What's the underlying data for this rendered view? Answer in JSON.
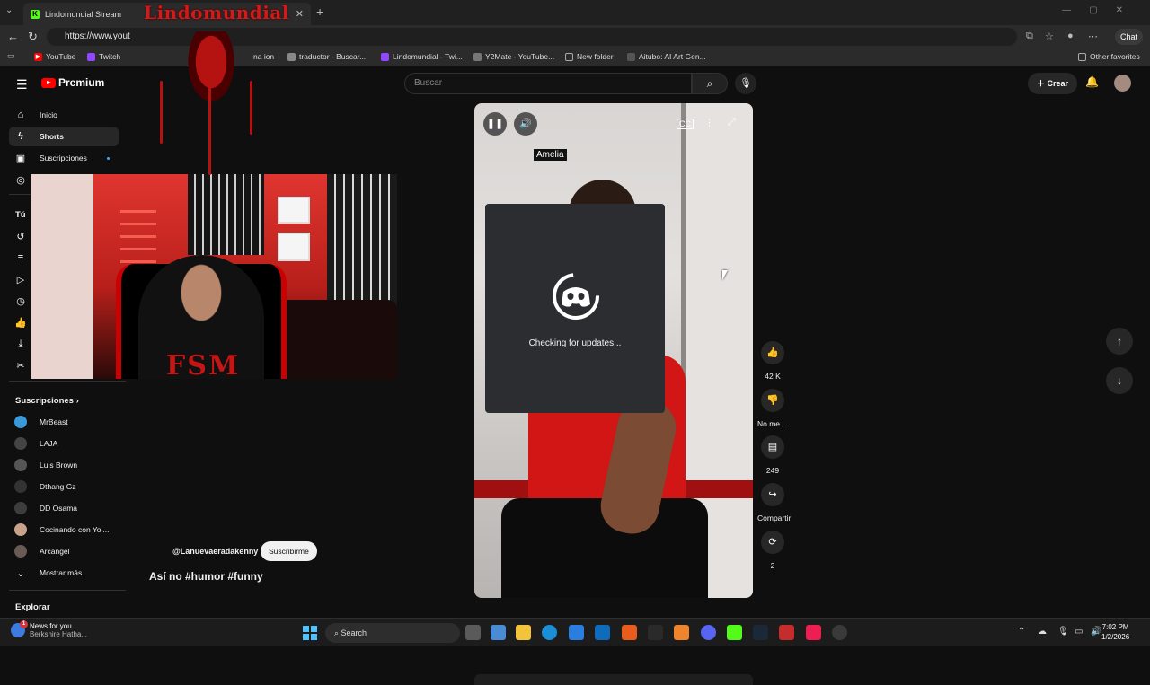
{
  "browser": {
    "tab_title": "Lindomundial Stream",
    "tab_close": "✕",
    "new_tab": "+",
    "url": "https://www.yout",
    "chat_label": "Chat",
    "bookmarks": [
      {
        "label": "YouTube",
        "color": "#ff0000"
      },
      {
        "label": "Twitch",
        "color": "#9146ff"
      },
      {
        "label": "na ion",
        "color": "#666666"
      },
      {
        "label": "traductor - Buscar...",
        "color": "#888888"
      },
      {
        "label": "Lindomundial - Twi...",
        "color": "#9146ff"
      },
      {
        "label": "Y2Mate - YouTube...",
        "color": "#777777"
      },
      {
        "label": "New folder",
        "color": "#aaaaaa"
      },
      {
        "label": "Aitubo: AI Art Gen...",
        "color": "#555555"
      }
    ],
    "other_favorites": "Other favorites"
  },
  "youtube": {
    "logo_text": "Premium",
    "search_placeholder": "Buscar",
    "create_label": "Crear",
    "sidebar": {
      "main": [
        {
          "label": "Inicio",
          "icon": "home-icon"
        },
        {
          "label": "Shorts",
          "icon": "shorts-icon"
        },
        {
          "label": "Suscripciones",
          "icon": "subscriptions-icon"
        }
      ],
      "you_heading": "Tú",
      "subs_heading": "Suscripciones",
      "subs": [
        {
          "name": "MrBeast",
          "color": "#3a9ad9"
        },
        {
          "name": "LAJA",
          "color": "#444444"
        },
        {
          "name": "Luis Brown",
          "color": "#555555"
        },
        {
          "name": "Dthang Gz",
          "color": "#333333"
        },
        {
          "name": "DD Osama",
          "color": "#3d3d3d"
        },
        {
          "name": "Cocinando con Yol...",
          "color": "#c9a28a"
        },
        {
          "name": "Arcangel",
          "color": "#6a5a55"
        }
      ],
      "show_more": "Mostrar más",
      "explore_heading": "Explorar"
    },
    "short": {
      "name_tag": "Amelia",
      "channel_handle": "@Lanuevaeradakenny",
      "subscribe_label": "Suscribirme",
      "caption": "Así no #humor #funny",
      "likes": "42 K",
      "dislike_label": "No me ...",
      "comments": "249",
      "share_label": "Compartir",
      "remix_count": "2"
    }
  },
  "overlay": {
    "logo_text": "Lindomundial",
    "cam_text": "FSM"
  },
  "updater": {
    "status": "Checking for updates..."
  },
  "taskbar": {
    "news_title": "News for you",
    "news_sub": "Berkshire Hatha...",
    "news_badge": "1",
    "search_label": "Search",
    "time": "7:02 PM",
    "date": "1/2/2026"
  }
}
